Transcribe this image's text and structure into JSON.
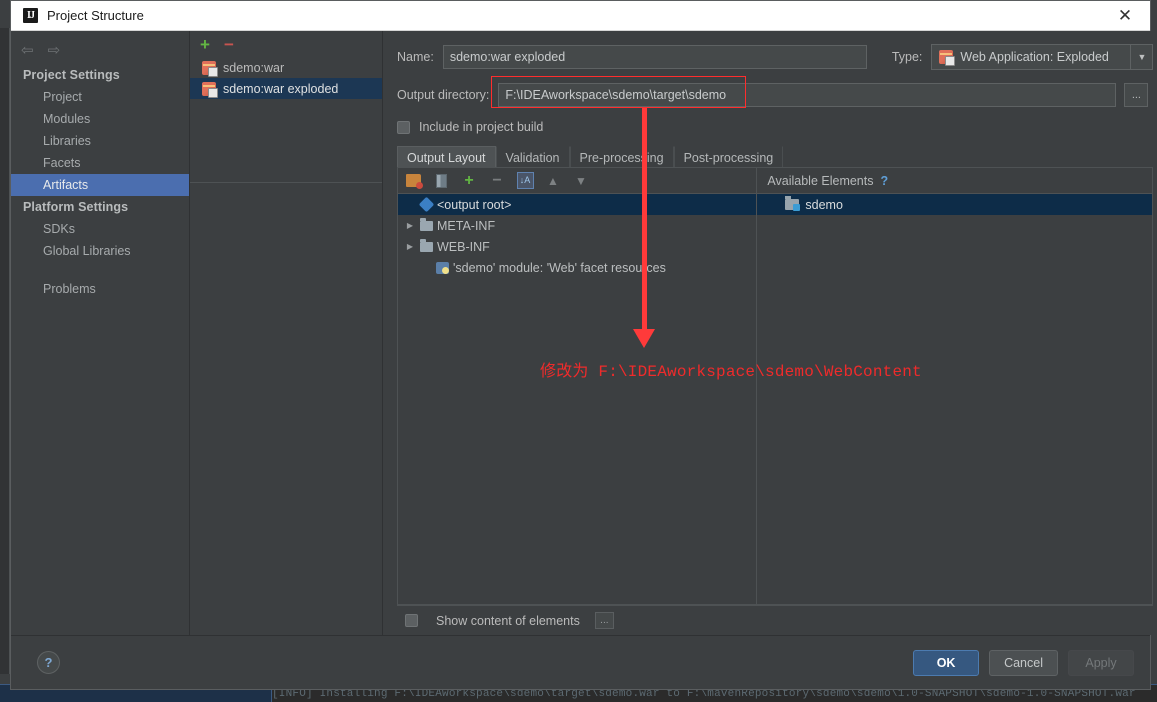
{
  "window": {
    "title": "Project Structure",
    "app_icon": "intellij-idea-icon",
    "close_icon": "✕"
  },
  "nav": {
    "back_icon": "⇦",
    "forward_icon": "⇨",
    "groups": [
      {
        "label": "Project Settings",
        "items": [
          {
            "label": "Project",
            "selected": false
          },
          {
            "label": "Modules",
            "selected": false
          },
          {
            "label": "Libraries",
            "selected": false
          },
          {
            "label": "Facets",
            "selected": false
          },
          {
            "label": "Artifacts",
            "selected": true
          }
        ]
      },
      {
        "label": "Platform Settings",
        "items": [
          {
            "label": "SDKs",
            "selected": false
          },
          {
            "label": "Global Libraries",
            "selected": false
          }
        ]
      }
    ],
    "problems": {
      "label": "Problems",
      "selected": false
    }
  },
  "artifacts": {
    "add_icon": "+",
    "remove_icon": "−",
    "items": [
      {
        "label": "sdemo:war",
        "selected": false
      },
      {
        "label": "sdemo:war exploded",
        "selected": true
      }
    ]
  },
  "detail": {
    "name_label": "Name:",
    "name_value": "sdemo:war exploded",
    "type_label": "Type:",
    "type_value": "Web Application: Exploded",
    "type_icon": "artifact-icon",
    "output_dir_label": "Output directory:",
    "output_dir_value": "F:\\IDEAworkspace\\sdemo\\target\\sdemo",
    "browse_label": "...",
    "include_in_build_label": "Include in project build",
    "include_in_build_checked": false,
    "tabs": [
      {
        "label": "Output Layout",
        "active": true
      },
      {
        "label": "Validation",
        "active": false
      },
      {
        "label": "Pre-processing",
        "active": false
      },
      {
        "label": "Post-processing",
        "active": false
      }
    ]
  },
  "layout_toolbar": {
    "buttons": [
      {
        "name": "create-archive-icon",
        "title": "Create Archive"
      },
      {
        "name": "create-directory-icon",
        "title": "Create Directory"
      },
      {
        "name": "add-copy-icon",
        "title": "Add"
      },
      {
        "name": "remove-icon",
        "title": "Remove"
      },
      {
        "name": "sort-icon",
        "title": "Sort"
      },
      {
        "name": "move-up-icon",
        "title": "Move Up"
      },
      {
        "name": "move-down-icon",
        "title": "Move Down"
      }
    ]
  },
  "output_tree": [
    {
      "label": "<output root>",
      "icon": "output-root-icon",
      "indent": 0,
      "expandable": false,
      "selected": true
    },
    {
      "label": "META-INF",
      "icon": "folder-icon",
      "indent": 0,
      "expandable": true,
      "selected": false
    },
    {
      "label": "WEB-INF",
      "icon": "folder-icon",
      "indent": 0,
      "expandable": true,
      "selected": false
    },
    {
      "label": "'sdemo' module: 'Web' facet resources",
      "icon": "facet-icon",
      "indent": 1,
      "expandable": false,
      "selected": false
    }
  ],
  "available": {
    "title": "Available Elements",
    "help_icon": "?",
    "items": [
      {
        "label": "sdemo",
        "icon": "module-icon",
        "selected": true
      }
    ]
  },
  "show_content": {
    "label": "Show content of elements",
    "checked": false,
    "more_label": "..."
  },
  "footer": {
    "help_icon": "?",
    "buttons": [
      {
        "label": "OK",
        "style": "primary"
      },
      {
        "label": "Cancel",
        "style": "normal"
      },
      {
        "label": "Apply",
        "style": "disabled"
      }
    ]
  },
  "annotation": {
    "text": "修改为 F:\\IDEAworkspace\\sdemo\\WebContent",
    "color": "#ef2b2b"
  },
  "background": {
    "console_line": "[INFO] Installing F:\\IDEAworkspace\\sdemo\\target\\sdemo.war to F:\\mavenRepository\\sdemo\\sdemo\\1.0-SNAPSHOT\\sdemo-1.0-SNAPSHOT.war"
  }
}
